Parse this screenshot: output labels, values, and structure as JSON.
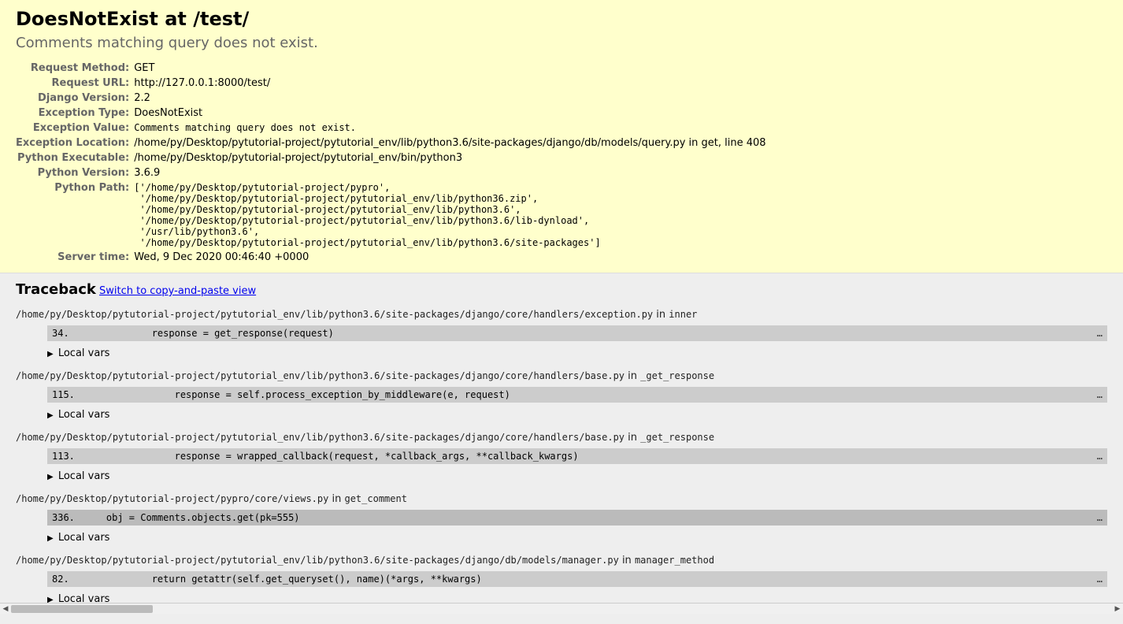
{
  "summary": {
    "title": "DoesNotExist at /test/",
    "subtitle": "Comments matching query does not exist.",
    "rows": {
      "request_method": {
        "label": "Request Method:",
        "value": "GET"
      },
      "request_url": {
        "label": "Request URL:",
        "value": "http://127.0.0.1:8000/test/"
      },
      "django_version": {
        "label": "Django Version:",
        "value": "2.2"
      },
      "exception_type": {
        "label": "Exception Type:",
        "value": "DoesNotExist"
      },
      "exception_value": {
        "label": "Exception Value:",
        "value": "Comments matching query does not exist."
      },
      "exception_location": {
        "label": "Exception Location:",
        "value": "/home/py/Desktop/pytutorial-project/pytutorial_env/lib/python3.6/site-packages/django/db/models/query.py in get, line 408"
      },
      "python_executable": {
        "label": "Python Executable:",
        "value": "/home/py/Desktop/pytutorial-project/pytutorial_env/bin/python3"
      },
      "python_version": {
        "label": "Python Version:",
        "value": "3.6.9"
      },
      "python_path": {
        "label": "Python Path:",
        "value": "['/home/py/Desktop/pytutorial-project/pypro',\n '/home/py/Desktop/pytutorial-project/pytutorial_env/lib/python36.zip',\n '/home/py/Desktop/pytutorial-project/pytutorial_env/lib/python3.6',\n '/home/py/Desktop/pytutorial-project/pytutorial_env/lib/python3.6/lib-dynload',\n '/usr/lib/python3.6',\n '/home/py/Desktop/pytutorial-project/pytutorial_env/lib/python3.6/site-packages']"
      },
      "server_time": {
        "label": "Server time:",
        "value": "Wed, 9 Dec 2020 00:46:40 +0000"
      }
    }
  },
  "traceback": {
    "heading": "Traceback",
    "switch_label": "Switch to copy-and-paste view",
    "localvars_label": "Local vars",
    "ellipsis": "…",
    "in_word": "in",
    "frames": [
      {
        "file": "/home/py/Desktop/pytutorial-project/pytutorial_env/lib/python3.6/site-packages/django/core/handlers/exception.py",
        "func": "inner",
        "lineno": "34.",
        "code": "            response = get_response(request)",
        "highlight": false
      },
      {
        "file": "/home/py/Desktop/pytutorial-project/pytutorial_env/lib/python3.6/site-packages/django/core/handlers/base.py",
        "func": "_get_response",
        "lineno": "115.",
        "code": "                response = self.process_exception_by_middleware(e, request)",
        "highlight": false
      },
      {
        "file": "/home/py/Desktop/pytutorial-project/pytutorial_env/lib/python3.6/site-packages/django/core/handlers/base.py",
        "func": "_get_response",
        "lineno": "113.",
        "code": "                response = wrapped_callback(request, *callback_args, **callback_kwargs)",
        "highlight": false
      },
      {
        "file": "/home/py/Desktop/pytutorial-project/pypro/core/views.py",
        "func": "get_comment",
        "lineno": "336.",
        "code": "    obj = Comments.objects.get(pk=555)",
        "highlight": true
      },
      {
        "file": "/home/py/Desktop/pytutorial-project/pytutorial_env/lib/python3.6/site-packages/django/db/models/manager.py",
        "func": "manager_method",
        "lineno": "82.",
        "code": "            return getattr(self.get_queryset(), name)(*args, **kwargs)",
        "highlight": false
      }
    ]
  }
}
